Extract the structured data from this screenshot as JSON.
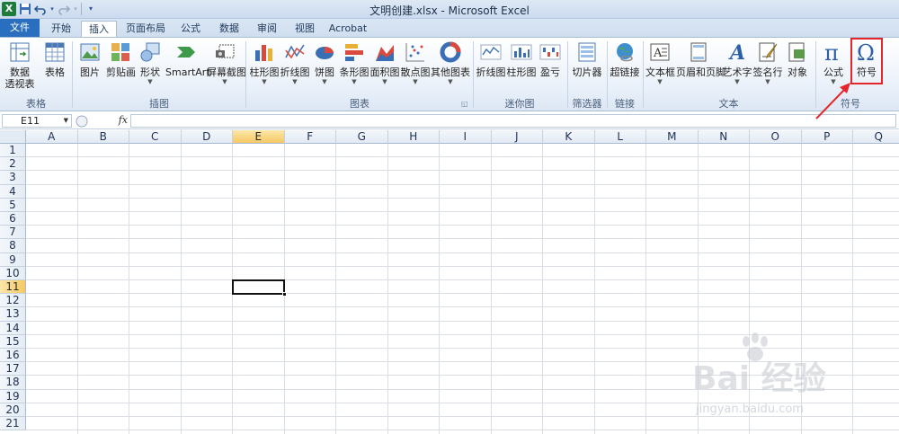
{
  "titlebar": {
    "app_logo": "X",
    "title": "文明创建.xlsx - Microsoft Excel",
    "quick_access": [
      "save-icon",
      "undo-icon",
      "redo-icon",
      "customize-icon"
    ]
  },
  "tabs": [
    "文件",
    "开始",
    "插入",
    "页面布局",
    "公式",
    "数据",
    "审阅",
    "视图",
    "Acrobat"
  ],
  "ribbon": {
    "groups": {
      "tables": "表格",
      "illustrations": "插图",
      "charts": "图表",
      "sparklines": "迷你图",
      "filter": "筛选器",
      "links": "链接",
      "text": "文本",
      "symbols": "符号"
    },
    "buttons": {
      "pivot_line1": "数据",
      "pivot_line2": "透视表",
      "table": "表格",
      "picture": "图片",
      "clipart": "剪贴画",
      "shapes": "形状",
      "smartart": "SmartArt",
      "screenshot": "屏幕截图",
      "column_chart": "柱形图",
      "line_chart": "折线图",
      "pie_chart": "饼图",
      "bar_chart": "条形图",
      "area_chart": "面积图",
      "scatter_chart": "散点图",
      "other_chart": "其他图表",
      "spark_line": "折线图",
      "spark_column": "柱形图",
      "spark_winloss": "盈亏",
      "slicer": "切片器",
      "hyperlink": "超链接",
      "textbox": "文本框",
      "header_footer": "页眉和页脚",
      "wordart": "艺术字",
      "signature": "签名行",
      "object": "对象",
      "equation": "公式",
      "symbol": "符号"
    }
  },
  "formula_bar": {
    "name_box": "E11",
    "fx_label": "fx",
    "value": ""
  },
  "grid": {
    "columns": [
      "A",
      "B",
      "C",
      "D",
      "E",
      "F",
      "G",
      "H",
      "I",
      "J",
      "K",
      "L",
      "M",
      "N",
      "O",
      "P",
      "Q"
    ],
    "rows": [
      "1",
      "2",
      "3",
      "4",
      "5",
      "6",
      "7",
      "8",
      "9",
      "10",
      "11",
      "12",
      "13",
      "14",
      "15",
      "16",
      "17",
      "18",
      "19",
      "20",
      "21"
    ],
    "active_column": "E",
    "active_row": "11"
  },
  "colors": {
    "accent_file_tab": "#2a6fbf",
    "highlight_box": "#e4262a",
    "active_header": "#f5c963"
  },
  "watermark": {
    "logo": "Bai 经验",
    "url": "jingyan.baidu.com"
  }
}
